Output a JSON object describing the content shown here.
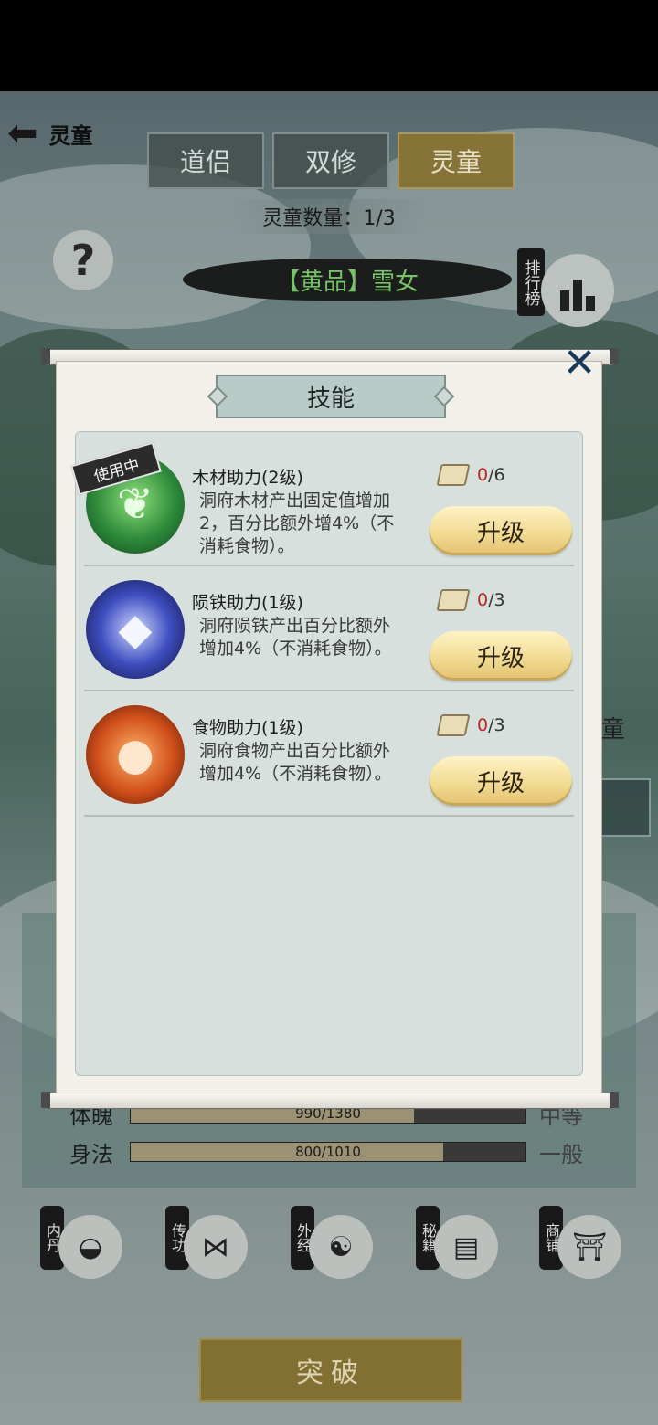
{
  "header": {
    "back_label": "灵童",
    "tabs": [
      {
        "label": "道侣",
        "active": false
      },
      {
        "label": "双修",
        "active": false
      },
      {
        "label": "灵童",
        "active": true
      }
    ],
    "count_text": "灵童数量：1/3",
    "help_icon": "?",
    "name_banner": "【黄品】雪女",
    "rank_label": "排行榜",
    "side_text": "童"
  },
  "stats": [
    {
      "name": "体魄",
      "value_text": "990/1380",
      "fraction": 0.717,
      "grade": "中等"
    },
    {
      "name": "身法",
      "value_text": "800/1010",
      "fraction": 0.792,
      "grade": "一般"
    }
  ],
  "functions": [
    {
      "label": "内丹",
      "icon": "yin-yang-icon",
      "glyph": "◒"
    },
    {
      "label": "传功",
      "icon": "share-icon",
      "glyph": "⋈"
    },
    {
      "label": "外经",
      "icon": "scroll-icon",
      "glyph": "☯"
    },
    {
      "label": "秘籍",
      "icon": "book-icon",
      "glyph": "▤"
    },
    {
      "label": "商铺",
      "icon": "shop-icon",
      "glyph": "⛩"
    }
  ],
  "breakthrough_label": "突破",
  "modal": {
    "title": "技能",
    "close_icon": "✕",
    "skills": [
      {
        "name": "木材助力(2级)",
        "desc": "洞府木材产出固定值增加2，百分比额外增4%（不消耗食物）。",
        "cost_have": "0",
        "cost_total": "/6",
        "upgrade_label": "升级",
        "in_use": true,
        "in_use_label": "使用中",
        "icon": "tree-icon",
        "glyph": "❦"
      },
      {
        "name": "陨铁助力(1级)",
        "desc": "洞府陨铁产出百分比额外增加4%（不消耗食物）。",
        "cost_have": "0",
        "cost_total": "/3",
        "upgrade_label": "升级",
        "in_use": false,
        "in_use_label": "",
        "icon": "crystal-icon",
        "glyph": "◆"
      },
      {
        "name": "食物助力(1级)",
        "desc": "洞府食物产出百分比额外增加4%（不消耗食物）。",
        "cost_have": "0",
        "cost_total": "/3",
        "upgrade_label": "升级",
        "in_use": false,
        "in_use_label": "",
        "icon": "meat-icon",
        "glyph": "●"
      }
    ]
  },
  "colors": {
    "cost_have": "#c0261c",
    "name_banner_text": "#7fce6d",
    "active_tab": "#8e7a3c"
  }
}
